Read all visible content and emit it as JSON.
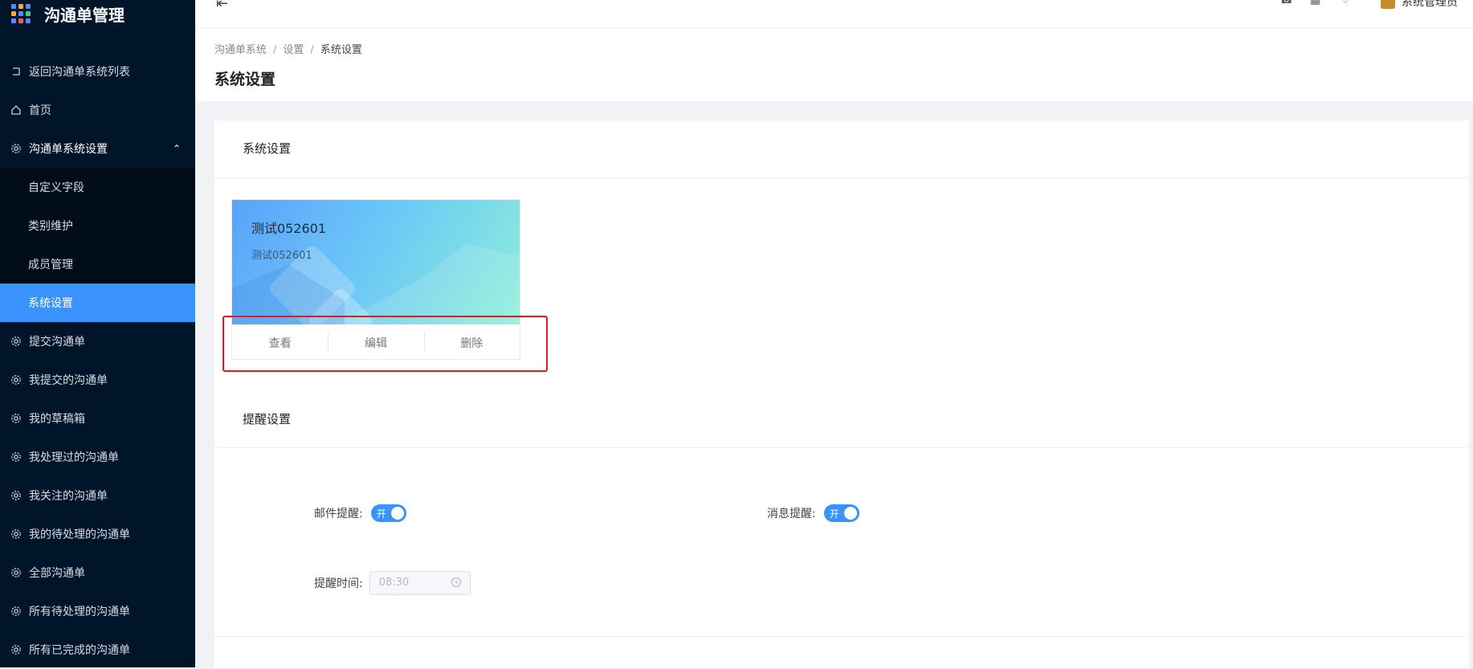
{
  "brand": {
    "title": "沟通单管理",
    "grid_colors": [
      "#4e8cff",
      "#f7a93b",
      "#4e8cff",
      "#f7a93b",
      "#4e8cff",
      "#3ecf8e",
      "#4e8cff",
      "#f25c5c",
      "#4e8cff"
    ]
  },
  "sidebar": {
    "items": [
      {
        "label": "返回沟通单系统列表",
        "icon": "back-icon"
      },
      {
        "label": "首页",
        "icon": "home-icon"
      },
      {
        "label": "沟通单系统设置",
        "icon": "gear-icon",
        "expanded": true
      }
    ],
    "submenu": [
      {
        "label": "自定义字段"
      },
      {
        "label": "类别维护"
      },
      {
        "label": "成员管理"
      },
      {
        "label": "系统设置",
        "active": true
      }
    ],
    "items_after": [
      {
        "label": "提交沟通单",
        "icon": "gear-icon"
      },
      {
        "label": "我提交的沟通单",
        "icon": "gear-icon"
      },
      {
        "label": "我的草稿箱",
        "icon": "gear-icon"
      },
      {
        "label": "我处理过的沟通单",
        "icon": "gear-icon"
      },
      {
        "label": "我关注的沟通单",
        "icon": "gear-icon"
      },
      {
        "label": "我的待处理的沟通单",
        "icon": "gear-icon"
      },
      {
        "label": "全部沟通单",
        "icon": "gear-icon"
      },
      {
        "label": "所有待处理的沟通单",
        "icon": "gear-icon"
      },
      {
        "label": "所有已完成的沟通单",
        "icon": "gear-icon"
      }
    ]
  },
  "header": {
    "user_name": "系统管理员"
  },
  "breadcrumb": [
    "沟通单系统",
    "设置",
    "系统设置"
  ],
  "page_title": "系统设置",
  "section_system": {
    "title": "系统设置"
  },
  "card": {
    "name": "测试052601",
    "description": "测试052601",
    "actions": {
      "view": "查看",
      "edit": "编辑",
      "delete": "删除"
    }
  },
  "section_reminder": {
    "title": "提醒设置",
    "email": {
      "label": "邮件提醒:",
      "switch_text": "开",
      "on": true
    },
    "message": {
      "label": "消息提醒:",
      "switch_text": "开",
      "on": true
    },
    "time": {
      "label": "提醒时间:",
      "value": "08:30"
    }
  },
  "colors": {
    "sidebar_bg": "#001529",
    "accent": "#3a92ff",
    "highlight": "#e51c1c"
  }
}
